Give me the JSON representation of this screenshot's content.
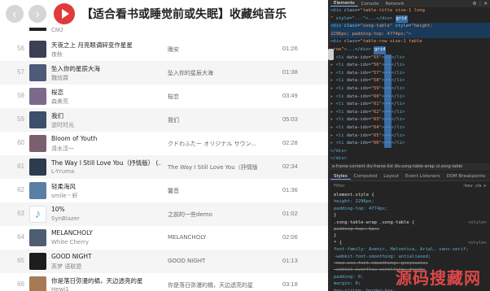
{
  "app": {
    "title": "【适合看书或睡觉前或失眠】收藏纯音乐",
    "nav_back_icon": "chevron-left",
    "nav_forward_icon": "chevron-right",
    "play_icon": "play",
    "accent": "#e03a3a",
    "partial_row": {
      "artist": "CMJ"
    },
    "songs": [
      {
        "num": "56",
        "title": "天夜之上 月亮眼谪碎变作星星",
        "artist": "夜秋",
        "album": "晚安",
        "duration": "01:26",
        "cover": "#3b4054"
      },
      {
        "num": "57",
        "title": "坠入你的星辰大海",
        "artist": "魏炫霖",
        "album": "坠入你的星辰大海",
        "duration": "01:38",
        "cover": "#4d5a78"
      },
      {
        "num": "58",
        "title": "桜恋",
        "artist": "森美亮",
        "album": "桜恋",
        "duration": "03:49",
        "cover": "#7d6a8a"
      },
      {
        "num": "59",
        "title": "我们",
        "artist": "逆时时光",
        "album": "我们",
        "duration": "05:03",
        "cover": "#3c4f6b"
      },
      {
        "num": "60",
        "title": "Bloom of Youth",
        "artist": "清水淳一",
        "album": "クドわふたー オリジナル サウン...",
        "duration": "02:28",
        "cover": "#7b5f6e"
      },
      {
        "num": "61",
        "title": "The Way I Still Love You（抒情版） (...",
        "artist": "L-Yruma",
        "album": "The Way I Still Love You（抒情版）",
        "duration": "02:34",
        "cover": "#2e3b4e"
      },
      {
        "num": "62",
        "title": "轻柔海风",
        "artist": "smile丶轩",
        "album": "馨音",
        "duration": "01:36",
        "cover": "#5a7fa5"
      },
      {
        "num": "63",
        "title": "10%",
        "artist": "SynBlazer",
        "album": "之前的一些demo",
        "duration": "01:02",
        "cover": "note"
      },
      {
        "num": "64",
        "title": "MELANCHOLY",
        "artist": "White Cherry",
        "album": "MELANCHOLY",
        "duration": "02:06",
        "cover": "#4f5d73"
      },
      {
        "num": "65",
        "title": "GOOD NIGHT",
        "artist": "英梦 语联盟",
        "album": "GOOD NIGHT",
        "duration": "01:13",
        "cover": "#1d1d1d"
      },
      {
        "num": "66",
        "title": "你是落日弥漫的橘，天边透亮的星",
        "artist": "Hewi1",
        "album": "你是落日弥漫的橘，天边透亮的星",
        "duration": "03:18",
        "cover": "#a57b55"
      }
    ]
  },
  "devtools": {
    "tabs": [
      "Elements",
      "Console",
      "Network"
    ],
    "active_tab": "Elements",
    "dom_lines": [
      {
        "parts": [
          {
            "c": "tag",
            "t": "<div "
          },
          {
            "c": "attr",
            "t": "class="
          },
          {
            "c": "val",
            "t": "\"table-title size-1 long"
          },
          {
            "c": "tag",
            "t": ""
          }
        ]
      },
      {
        "parts": [
          {
            "c": "val",
            "t": "\""
          },
          {
            "c": "tag",
            "t": " style=\""
          },
          {
            "c": "tag",
            "t": "..."
          },
          {
            "c": "tag",
            "t": "\">...</div> "
          },
          {
            "c": "badge",
            "t": "grid"
          }
        ]
      },
      {
        "parts": [
          {
            "c": "tag",
            "t": "<div "
          },
          {
            "c": "attr",
            "t": "class="
          },
          {
            "c": "val",
            "t": "\"song-table\""
          },
          {
            "c": "attr",
            "t": " style="
          },
          {
            "c": "val",
            "t": "\"height:"
          }
        ],
        "sel": true
      },
      {
        "parts": [
          {
            "c": "val",
            "t": "2296px; padding-top: 4774px;\""
          },
          {
            "c": "tag",
            "t": ">"
          }
        ],
        "sel": true
      },
      {
        "parts": [
          {
            "c": "tag",
            "t": "  <div "
          },
          {
            "c": "attr",
            "t": "class="
          },
          {
            "c": "val",
            "t": "\"table-row size-1 table"
          }
        ]
      },
      {
        "parts": [
          {
            "c": "val",
            "t": "-row\""
          },
          {
            "c": "tag",
            "t": ">"
          },
          {
            "c": "tag",
            "t": "...</div> "
          },
          {
            "c": "badge",
            "t": "grid"
          }
        ]
      },
      {
        "parts": [
          {
            "c": "tag",
            "t": "  ▸ <li "
          },
          {
            "c": "attr",
            "t": "data-idx="
          },
          {
            "c": "val",
            "t": "\"55\""
          },
          {
            "c": "tag",
            "t": ">"
          },
          {
            "c": "badge",
            "t": "··"
          },
          {
            "c": "tag",
            "t": "</li>"
          }
        ]
      },
      {
        "parts": [
          {
            "c": "tag",
            "t": "  ▸ <li "
          },
          {
            "c": "attr",
            "t": "data-idx="
          },
          {
            "c": "val",
            "t": "\"56\""
          },
          {
            "c": "tag",
            "t": ">"
          },
          {
            "c": "badge",
            "t": "··"
          },
          {
            "c": "tag",
            "t": "</li>"
          }
        ]
      },
      {
        "parts": [
          {
            "c": "tag",
            "t": "  ▸ <li "
          },
          {
            "c": "attr",
            "t": "data-idx="
          },
          {
            "c": "val",
            "t": "\"57\""
          },
          {
            "c": "tag",
            "t": ">"
          },
          {
            "c": "badge",
            "t": "··"
          },
          {
            "c": "tag",
            "t": "</li>"
          }
        ]
      },
      {
        "parts": [
          {
            "c": "tag",
            "t": "  ▸ <li "
          },
          {
            "c": "attr",
            "t": "data-idx="
          },
          {
            "c": "val",
            "t": "\"58\""
          },
          {
            "c": "tag",
            "t": ">"
          },
          {
            "c": "badge",
            "t": "··"
          },
          {
            "c": "tag",
            "t": "</li>"
          }
        ]
      },
      {
        "parts": [
          {
            "c": "tag",
            "t": "  ▸ <li "
          },
          {
            "c": "attr",
            "t": "data-idx="
          },
          {
            "c": "val",
            "t": "\"59\""
          },
          {
            "c": "tag",
            "t": ">"
          },
          {
            "c": "badge",
            "t": "··"
          },
          {
            "c": "tag",
            "t": "</li>"
          }
        ]
      },
      {
        "parts": [
          {
            "c": "tag",
            "t": "  ▸ <li "
          },
          {
            "c": "attr",
            "t": "data-idx="
          },
          {
            "c": "val",
            "t": "\"60\""
          },
          {
            "c": "tag",
            "t": ">"
          },
          {
            "c": "badge",
            "t": "··"
          },
          {
            "c": "tag",
            "t": "</li>"
          }
        ]
      },
      {
        "parts": [
          {
            "c": "tag",
            "t": "  ▸ <li "
          },
          {
            "c": "attr",
            "t": "data-idx="
          },
          {
            "c": "val",
            "t": "\"61\""
          },
          {
            "c": "tag",
            "t": ">"
          },
          {
            "c": "badge",
            "t": "··"
          },
          {
            "c": "tag",
            "t": "</li>"
          }
        ]
      },
      {
        "parts": [
          {
            "c": "tag",
            "t": "  ▸ <li "
          },
          {
            "c": "attr",
            "t": "data-idx="
          },
          {
            "c": "val",
            "t": "\"62\""
          },
          {
            "c": "tag",
            "t": ">"
          },
          {
            "c": "badge",
            "t": "··"
          },
          {
            "c": "tag",
            "t": "</li>"
          }
        ]
      },
      {
        "parts": [
          {
            "c": "tag",
            "t": "  ▸ <li "
          },
          {
            "c": "attr",
            "t": "data-idx="
          },
          {
            "c": "val",
            "t": "\"63\""
          },
          {
            "c": "tag",
            "t": ">"
          },
          {
            "c": "badge",
            "t": "··"
          },
          {
            "c": "tag",
            "t": "</li>"
          }
        ]
      },
      {
        "parts": [
          {
            "c": "tag",
            "t": "  ▸ <li "
          },
          {
            "c": "attr",
            "t": "data-idx="
          },
          {
            "c": "val",
            "t": "\"64\""
          },
          {
            "c": "tag",
            "t": ">"
          },
          {
            "c": "badge",
            "t": "··"
          },
          {
            "c": "tag",
            "t": "</li>"
          }
        ]
      },
      {
        "parts": [
          {
            "c": "tag",
            "t": "  ▸ <li "
          },
          {
            "c": "attr",
            "t": "data-idx="
          },
          {
            "c": "val",
            "t": "\"65\""
          },
          {
            "c": "tag",
            "t": ">"
          },
          {
            "c": "badge",
            "t": "··"
          },
          {
            "c": "tag",
            "t": "</li>"
          }
        ]
      },
      {
        "parts": [
          {
            "c": "tag",
            "t": "  ▸ <li "
          },
          {
            "c": "attr",
            "t": "data-idx="
          },
          {
            "c": "val",
            "t": "\"66\""
          },
          {
            "c": "tag",
            "t": ">"
          },
          {
            "c": "badge",
            "t": "··"
          },
          {
            "c": "tag",
            "t": "</li>"
          }
        ]
      },
      {
        "parts": [
          {
            "c": "tag",
            "t": "  </div>"
          }
        ]
      },
      {
        "parts": [
          {
            "c": "tag",
            "t": "</div>"
          }
        ]
      }
    ],
    "breadcrumbs": "e-frame-content   div.frame-list   div.song-table-wrap   ul.song-table",
    "sub_tabs": [
      "Styles",
      "Computed",
      "Layout",
      "Event Listeners",
      "DOM Breakpoints"
    ],
    "active_sub_tab": "Styles",
    "filter_placeholder": "Filter",
    "filter_right": ":hov  .cls  +",
    "style_lines": [
      {
        "t": "element.style {",
        "cls": "pv"
      },
      {
        "t": "  height: 2296px;",
        "cls": "prop"
      },
      {
        "t": "  padding-top: 4774px;",
        "cls": "prop"
      },
      {
        "t": "}",
        "cls": "pv"
      },
      {
        "t": ".song-table-wrap .song-table {",
        "cls": "pv",
        "src": "<style>"
      },
      {
        "t": "  padding-top: 6px;",
        "cls": "strike"
      },
      {
        "t": "}",
        "cls": "pv"
      },
      {
        "t": "* {",
        "cls": "pv",
        "src": "<style>"
      },
      {
        "t": "  font-family: Avenir, Helvetica, Arial, sans-serif;",
        "cls": "prop"
      },
      {
        "t": "  -webkit-font-smoothing: antialiased;",
        "cls": "prop"
      },
      {
        "t": "  -moz-osx-font-smoothing: grayscale;",
        "cls": "strike"
      },
      {
        "t": "  -webkit-overflow-scrolling: touch;",
        "cls": "strike"
      },
      {
        "t": "  padding: 0;",
        "cls": "prop"
      },
      {
        "t": "  margin: 0;",
        "cls": "prop"
      },
      {
        "t": "  box-sizing: border-box;",
        "cls": "prop"
      },
      {
        "t": "  background: transparent;",
        "cls": "prop"
      }
    ]
  },
  "watermark": "源码搜藏网"
}
